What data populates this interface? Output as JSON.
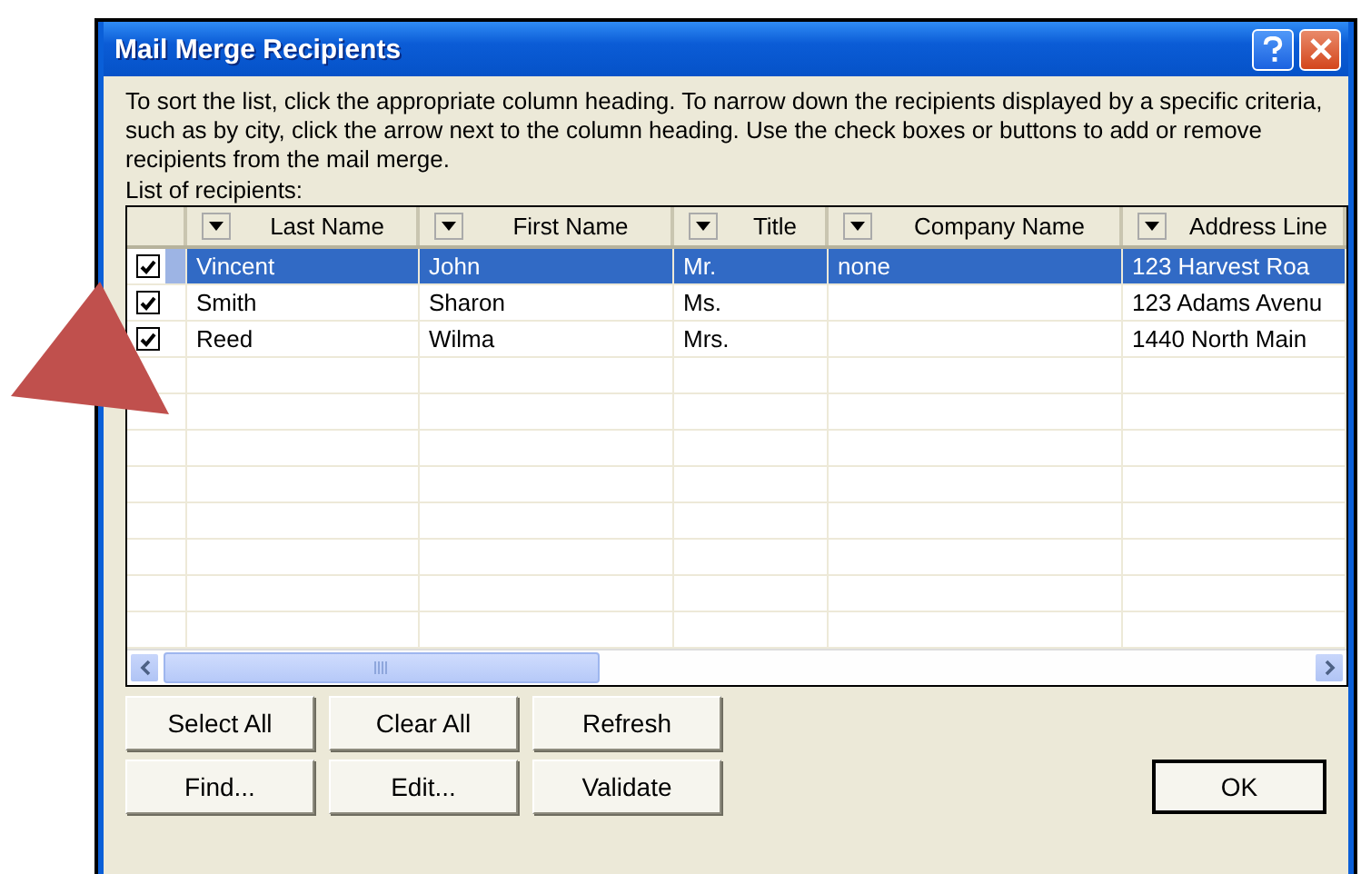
{
  "window": {
    "title": "Mail Merge Recipients"
  },
  "instructions": "To sort the list, click the appropriate column heading.  To narrow down the recipients displayed by a specific criteria, such as by city, click the arrow next to the column heading.  Use the check boxes or buttons to add or remove recipients from the mail merge.",
  "list_label": "List of recipients:",
  "table": {
    "columns": [
      "Last Name",
      "First Name",
      "Title",
      "Company Name",
      "Address Line"
    ],
    "rows": [
      {
        "checked": true,
        "selected": true,
        "last_name": "Vincent",
        "first_name": "John",
        "title": "Mr.",
        "company_name": "none",
        "address_line": "123 Harvest Roa"
      },
      {
        "checked": true,
        "selected": false,
        "last_name": "Smith",
        "first_name": "Sharon",
        "title": "Ms.",
        "address_line": "123 Adams Avenu"
      },
      {
        "checked": true,
        "selected": false,
        "last_name": "Reed",
        "first_name": "Wilma",
        "title": "Mrs.",
        "address_line": "1440 North Main"
      }
    ]
  },
  "buttons": [
    "Select All",
    "Clear All",
    "Refresh",
    "Find...",
    "Edit...",
    "Validate"
  ],
  "ok_button": "OK"
}
